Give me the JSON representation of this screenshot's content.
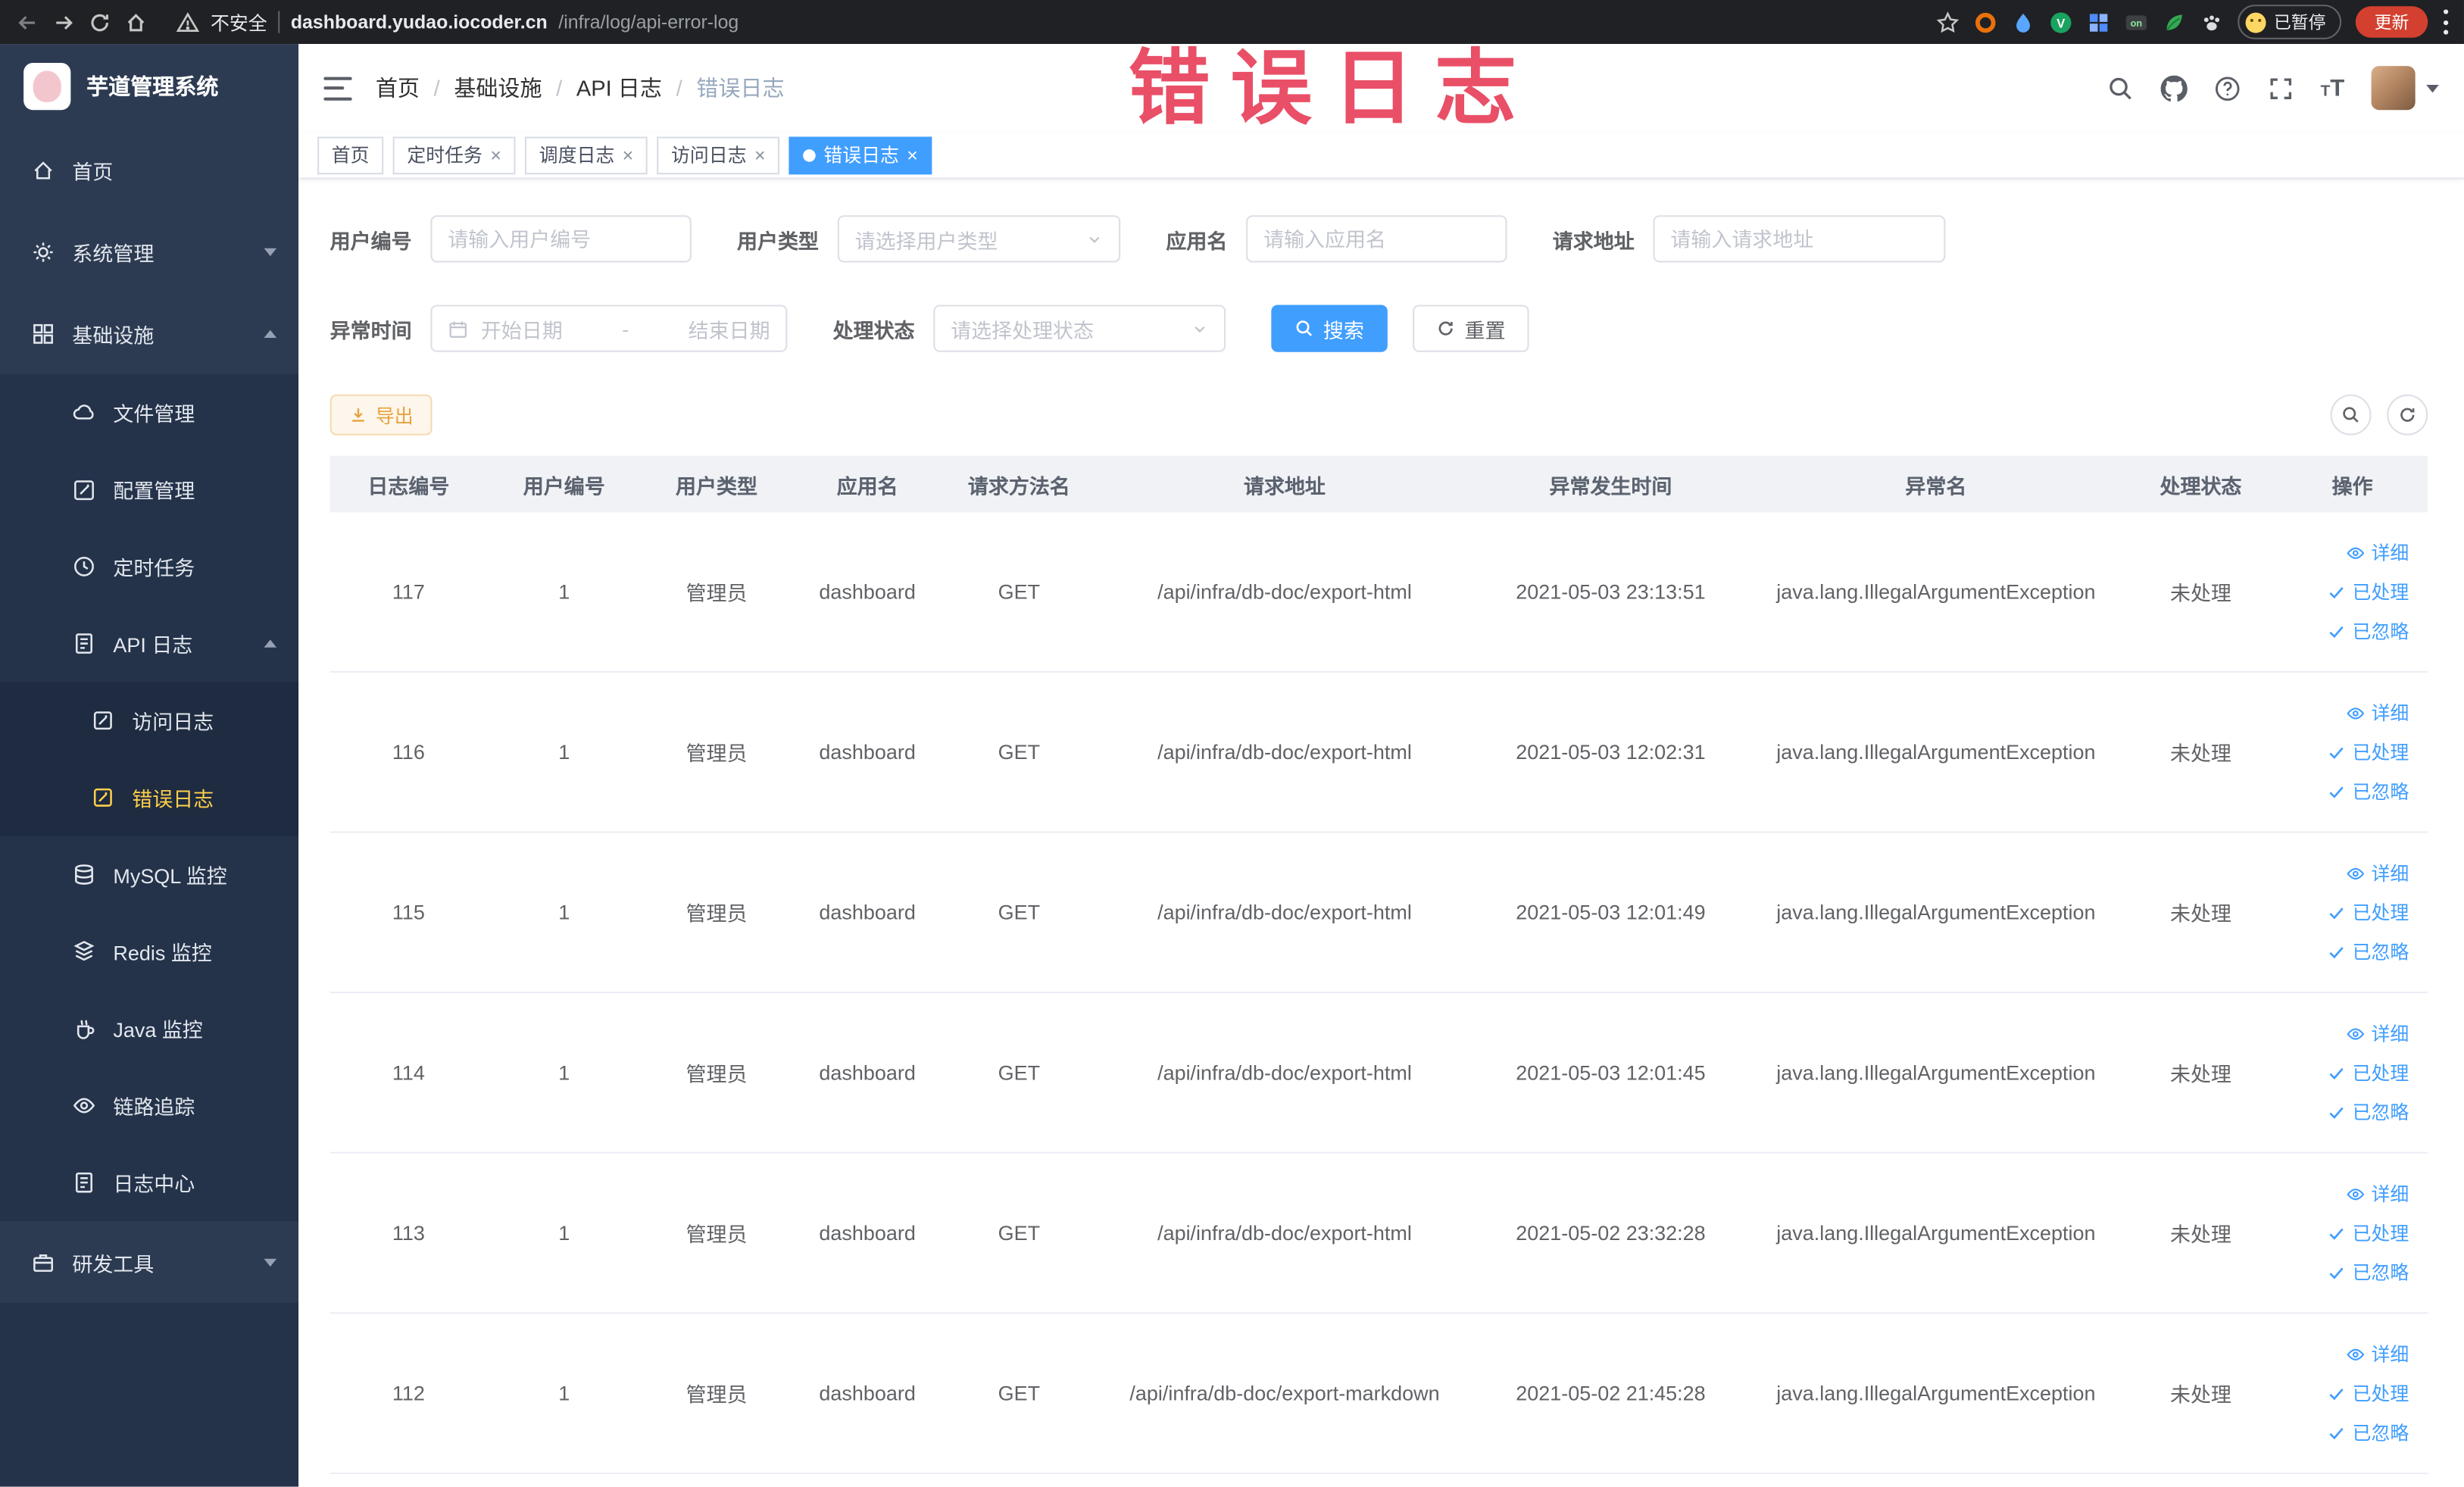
{
  "annotation": {
    "text": "错误日志"
  },
  "browser": {
    "security_label": "不安全",
    "url_host": "dashboard.yudao.iocoder.cn",
    "url_path": "/infra/log/api-error-log",
    "extension_on_badge": "on",
    "extension_v_logo": "V",
    "paused_badge": "已暂停",
    "update_button": "更新"
  },
  "sidebar": {
    "logo_title": "芋道管理系统",
    "items": [
      {
        "label": "首页"
      },
      {
        "label": "系统管理"
      },
      {
        "label": "基础设施"
      },
      {
        "label": "文件管理"
      },
      {
        "label": "配置管理"
      },
      {
        "label": "定时任务"
      },
      {
        "label": "API 日志"
      },
      {
        "label": "访问日志"
      },
      {
        "label": "错误日志"
      },
      {
        "label": "MySQL 监控"
      },
      {
        "label": "Redis 监控"
      },
      {
        "label": "Java 监控"
      },
      {
        "label": "链路追踪"
      },
      {
        "label": "日志中心"
      },
      {
        "label": "研发工具"
      }
    ]
  },
  "header": {
    "breadcrumb": [
      {
        "label": "首页"
      },
      {
        "label": "基础设施"
      },
      {
        "label": "API 日志"
      },
      {
        "label": "错误日志"
      }
    ]
  },
  "tabs": [
    {
      "label": "首页"
    },
    {
      "label": "定时任务"
    },
    {
      "label": "调度日志"
    },
    {
      "label": "访问日志"
    },
    {
      "label": "错误日志"
    }
  ],
  "filters": {
    "user_id": {
      "label": "用户编号",
      "placeholder": "请输入用户编号"
    },
    "user_type": {
      "label": "用户类型",
      "placeholder": "请选择用户类型"
    },
    "app_name": {
      "label": "应用名",
      "placeholder": "请输入应用名"
    },
    "request_url": {
      "label": "请求地址",
      "placeholder": "请输入请求地址"
    },
    "exception_time": {
      "label": "异常时间",
      "start_placeholder": "开始日期",
      "separator": "-",
      "end_placeholder": "结束日期"
    },
    "process_status": {
      "label": "处理状态",
      "placeholder": "请选择处理状态"
    },
    "search_button": "搜索",
    "reset_button": "重置"
  },
  "toolbar": {
    "export_button": "导出"
  },
  "table": {
    "columns": [
      "日志编号",
      "用户编号",
      "用户类型",
      "应用名",
      "请求方法名",
      "请求地址",
      "异常发生时间",
      "异常名",
      "处理状态",
      "操作"
    ],
    "action_labels": {
      "detail": "详细",
      "processed": "已处理",
      "ignored": "已忽略"
    },
    "rows": [
      {
        "id": "117",
        "user_id": "1",
        "user_type": "管理员",
        "app": "dashboard",
        "method": "GET",
        "url": "/api/infra/db-doc/export-html",
        "time": "2021-05-03 23:13:51",
        "exception": "java.lang.IllegalArgumentException",
        "status": "未处理"
      },
      {
        "id": "116",
        "user_id": "1",
        "user_type": "管理员",
        "app": "dashboard",
        "method": "GET",
        "url": "/api/infra/db-doc/export-html",
        "time": "2021-05-03 12:02:31",
        "exception": "java.lang.IllegalArgumentException",
        "status": "未处理"
      },
      {
        "id": "115",
        "user_id": "1",
        "user_type": "管理员",
        "app": "dashboard",
        "method": "GET",
        "url": "/api/infra/db-doc/export-html",
        "time": "2021-05-03 12:01:49",
        "exception": "java.lang.IllegalArgumentException",
        "status": "未处理"
      },
      {
        "id": "114",
        "user_id": "1",
        "user_type": "管理员",
        "app": "dashboard",
        "method": "GET",
        "url": "/api/infra/db-doc/export-html",
        "time": "2021-05-03 12:01:45",
        "exception": "java.lang.IllegalArgumentException",
        "status": "未处理"
      },
      {
        "id": "113",
        "user_id": "1",
        "user_type": "管理员",
        "app": "dashboard",
        "method": "GET",
        "url": "/api/infra/db-doc/export-html",
        "time": "2021-05-02 23:32:28",
        "exception": "java.lang.IllegalArgumentException",
        "status": "未处理"
      },
      {
        "id": "112",
        "user_id": "1",
        "user_type": "管理员",
        "app": "dashboard",
        "method": "GET",
        "url": "/api/infra/db-doc/export-markdown",
        "time": "2021-05-02 21:45:28",
        "exception": "java.lang.IllegalArgumentException",
        "status": "未处理"
      }
    ]
  },
  "colors": {
    "primary": "#409eff",
    "sidebar_active": "#ffd04b",
    "warning": "#e6a23c",
    "annotation_red": "#e8465f",
    "update_button_red": "#d3402f"
  }
}
